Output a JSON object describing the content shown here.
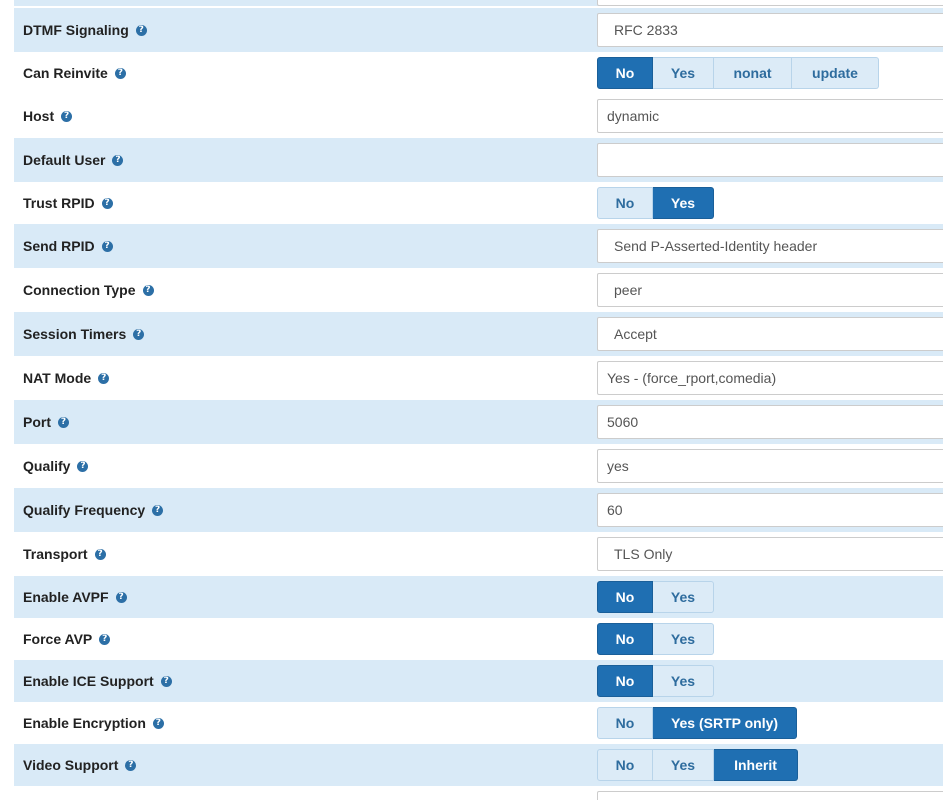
{
  "help_glyph": "?",
  "rows": {
    "dtmf_signaling": {
      "label": "DTMF Signaling",
      "value": "RFC 2833"
    },
    "can_reinvite": {
      "label": "Can Reinvite",
      "options": [
        "No",
        "Yes",
        "nonat",
        "update"
      ],
      "selected": "No"
    },
    "host": {
      "label": "Host",
      "value": "dynamic"
    },
    "default_user": {
      "label": "Default User",
      "value": ""
    },
    "trust_rpid": {
      "label": "Trust RPID",
      "options": [
        "No",
        "Yes"
      ],
      "selected": "Yes"
    },
    "send_rpid": {
      "label": "Send RPID",
      "value": "Send P-Asserted-Identity header"
    },
    "connection_type": {
      "label": "Connection Type",
      "value": "peer"
    },
    "session_timers": {
      "label": "Session Timers",
      "value": "Accept"
    },
    "nat_mode": {
      "label": "NAT Mode",
      "value": "Yes - (force_rport,comedia)"
    },
    "port": {
      "label": "Port",
      "value": "5060"
    },
    "qualify": {
      "label": "Qualify",
      "value": "yes"
    },
    "qualify_frequency": {
      "label": "Qualify Frequency",
      "value": "60"
    },
    "transport": {
      "label": "Transport",
      "value": "TLS Only"
    },
    "enable_avpf": {
      "label": "Enable AVPF",
      "options": [
        "No",
        "Yes"
      ],
      "selected": "No"
    },
    "force_avp": {
      "label": "Force AVP",
      "options": [
        "No",
        "Yes"
      ],
      "selected": "No"
    },
    "enable_ice_support": {
      "label": "Enable ICE Support",
      "options": [
        "No",
        "Yes"
      ],
      "selected": "No"
    },
    "enable_encryption": {
      "label": "Enable Encryption",
      "options": [
        "No",
        "Yes (SRTP only)"
      ],
      "selected": "Yes (SRTP only)"
    },
    "video_support": {
      "label": "Video Support",
      "options": [
        "No",
        "Yes",
        "Inherit"
      ],
      "selected": "Inherit"
    }
  },
  "colors": {
    "row_alt_bg": "#d9eaf7",
    "active_button": "#1f6fb2",
    "inactive_button": "#dcebf7",
    "help_icon": "#2c6fa6"
  }
}
